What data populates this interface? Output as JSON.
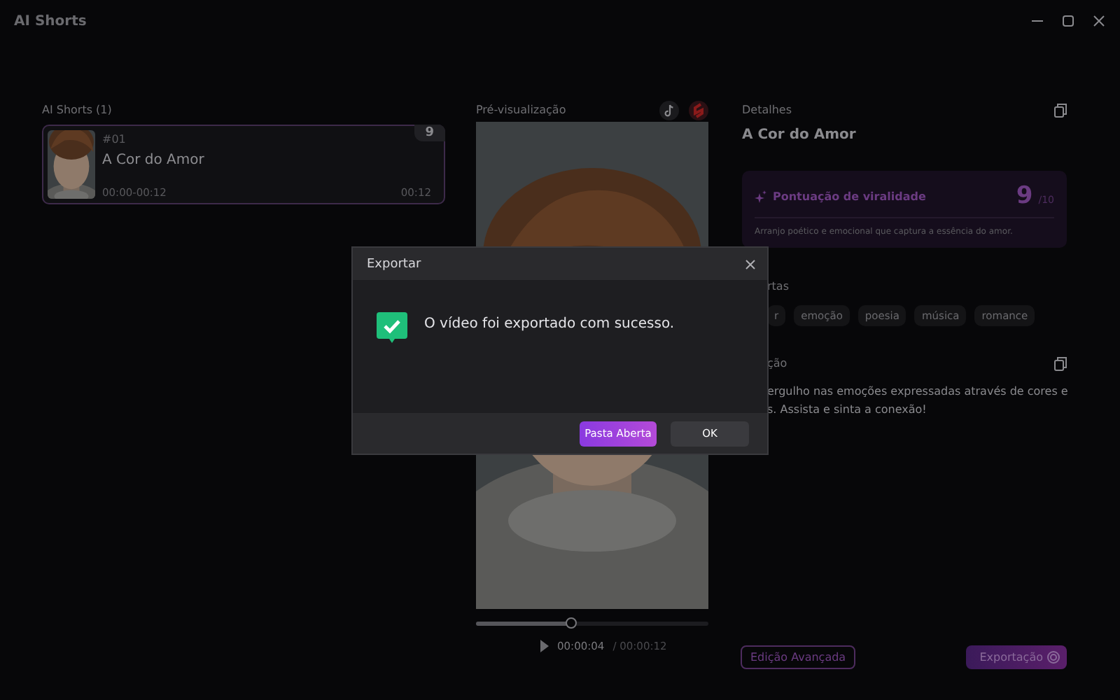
{
  "window": {
    "title": "AI Shorts"
  },
  "shorts_list": {
    "heading": "AI Shorts (1)",
    "items": [
      {
        "index": "#01",
        "title": "A Cor do Amor",
        "range": "00:00-00:12",
        "duration": "00:12",
        "score": "9",
        "selected": true
      }
    ]
  },
  "preview": {
    "heading": "Pré-visualização",
    "player": {
      "level": 0.41,
      "current": "00:00:04",
      "total": "/ 00:00:12"
    }
  },
  "details": {
    "heading": "Detalhes",
    "title": "A Cor do Amor",
    "virality": {
      "label": "Pontuação de viralidade",
      "score": "9",
      "max": "/10",
      "summary": "Arranjo poético e emocional que captura a essência do amor."
    },
    "tags_heading": "rtas",
    "tags": [
      "r",
      "emoção",
      "poesia",
      "música",
      "romance"
    ],
    "description_heading": "ção",
    "description_lines": [
      "ergulho nas emoções expressadas através de cores e",
      "s. Assista e sinta a conexão!"
    ]
  },
  "actions": [
    {
      "label": "Edição Avançada",
      "kind": "outline"
    },
    {
      "label": "Exportação",
      "kind": "primary"
    }
  ],
  "dialog": {
    "title": "Exportar",
    "message": "O vídeo foi exportado com sucesso.",
    "buttons": [
      {
        "label": "Pasta Aberta",
        "kind": "primary"
      },
      {
        "label": "OK",
        "kind": "secondary"
      }
    ]
  }
}
